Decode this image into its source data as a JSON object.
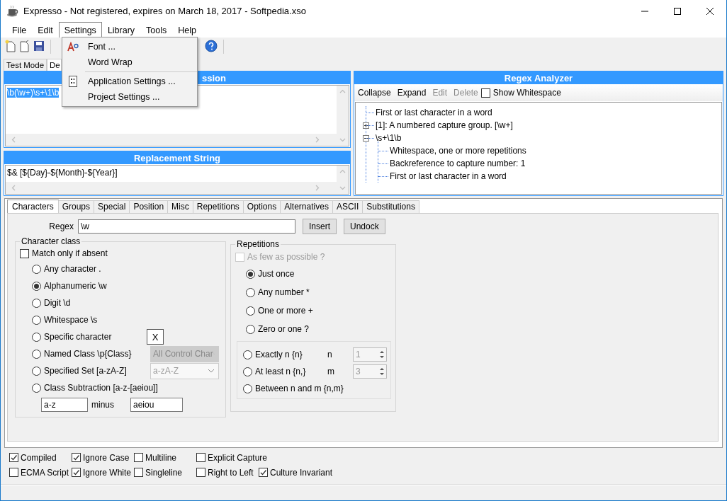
{
  "window": {
    "title": "Expresso - Not registered, expires on March 18, 2017 - Softpedia.xso"
  },
  "menu": [
    {
      "label": "File",
      "selected": false
    },
    {
      "label": "Edit",
      "selected": false
    },
    {
      "label": "Settings",
      "selected": true
    },
    {
      "label": "Library",
      "selected": false
    },
    {
      "label": "Tools",
      "selected": false
    },
    {
      "label": "Help",
      "selected": false
    }
  ],
  "settings_menu": [
    {
      "kind": "font",
      "label": "Font ..."
    },
    {
      "kind": "plain",
      "label": "Word Wrap"
    },
    {
      "kind": "separator"
    },
    {
      "kind": "settings",
      "label": "Application Settings ..."
    },
    {
      "kind": "plain",
      "label": "Project Settings ..."
    }
  ],
  "mode_tabs": [
    {
      "label": "Test Mode",
      "selected": false
    },
    {
      "label": "De",
      "selected": true
    }
  ],
  "expression_panel": {
    "title": "ssion",
    "value": "\\b(\\w+)\\s+\\1\\b",
    "text_selected": true
  },
  "replacement_panel": {
    "title": "Replacement String",
    "value": "$& [${Day}-${Month}-${Year}]"
  },
  "analyzer": {
    "title": "Regex Analyzer",
    "actions": [
      {
        "label": "Collapse",
        "disabled": false
      },
      {
        "label": "Expand",
        "disabled": false
      },
      {
        "label": "Edit",
        "disabled": true
      },
      {
        "label": "Delete",
        "disabled": true
      }
    ],
    "show_whitespace": {
      "label": "Show Whitespace",
      "checked": false
    },
    "tree": [
      {
        "label": "First or last character in a word"
      },
      {
        "label": "[1]: A numbered capture group. [\\w+]",
        "expanded": false
      },
      {
        "label": "\\s+\\1\\b",
        "expanded": true,
        "children": [
          {
            "label": "Whitespace, one or more repetitions"
          },
          {
            "label": "Backreference to capture number: 1"
          },
          {
            "label": "First or last character in a word"
          }
        ]
      }
    ]
  },
  "builder": {
    "tabs": [
      {
        "label": "Characters",
        "selected": true
      },
      {
        "label": "Groups",
        "selected": false
      },
      {
        "label": "Special",
        "selected": false
      },
      {
        "label": "Position",
        "selected": false
      },
      {
        "label": "Misc",
        "selected": false
      },
      {
        "label": "Repetitions",
        "selected": false
      },
      {
        "label": "Options",
        "selected": false
      },
      {
        "label": "Alternatives",
        "selected": false
      },
      {
        "label": "ASCII",
        "selected": false
      },
      {
        "label": "Substitutions",
        "selected": false
      }
    ],
    "regex": {
      "label": "Regex",
      "value": "\\w"
    },
    "buttons": [
      "Insert",
      "Undock"
    ],
    "character_class": {
      "title": "Character class",
      "match_only_if_absent": {
        "label": "Match only if absent",
        "checked": false
      },
      "options": [
        {
          "kind": "plain",
          "label": "Any character .",
          "selected": false
        },
        {
          "kind": "plain",
          "label": "Alphanumeric \\w",
          "selected": true
        },
        {
          "kind": "plain",
          "label": "Digit \\d",
          "selected": false
        },
        {
          "kind": "plain",
          "label": "Whitespace \\s",
          "selected": false
        },
        {
          "kind": "char",
          "label": "Specific character",
          "selected": false,
          "value": "X"
        },
        {
          "kind": "select",
          "label": "Named Class \\p{Class}",
          "selected": false,
          "value": "All Control Char",
          "disabled": true
        },
        {
          "kind": "select",
          "label": "Specified Set [a-zA-Z]",
          "selected": false,
          "value": "a-zA-Z",
          "disabled": false
        },
        {
          "kind": "plain",
          "label": "Class Subtraction [a-z-[aeiou]]",
          "selected": false
        }
      ],
      "subtraction": {
        "from": "a-z",
        "minus_label": "minus",
        "minus": "aeiou"
      }
    },
    "repetitions": {
      "title": "Repetitions",
      "as_few": {
        "label": "As few as possible ?",
        "checked": false,
        "disabled": true
      },
      "options": [
        {
          "label": "Just once",
          "selected": true
        },
        {
          "label": "Any number *",
          "selected": false
        },
        {
          "label": "One or more +",
          "selected": false
        },
        {
          "label": "Zero or one ?",
          "selected": false
        }
      ],
      "counts": [
        {
          "label": "Exactly n {n}",
          "selected": false,
          "param": "n",
          "value": "1"
        },
        {
          "label": "At least n {n,}",
          "selected": false,
          "param": "m",
          "value": "3"
        },
        {
          "label": "Between n and m {n,m}",
          "selected": false
        }
      ]
    }
  },
  "options": {
    "rows": [
      [
        {
          "label": "Compiled",
          "checked": true
        },
        {
          "label": "Ignore Case",
          "checked": true
        },
        {
          "label": "Multiline",
          "checked": false
        },
        {
          "label": "Explicit Capture",
          "checked": false
        }
      ],
      [
        {
          "label": "ECMA Script",
          "checked": false
        },
        {
          "label": "Ignore White",
          "checked": true
        },
        {
          "label": "Singleline",
          "checked": false
        },
        {
          "label": "Right to Left",
          "checked": false
        },
        {
          "label": "Culture Invariant",
          "checked": true
        }
      ]
    ]
  }
}
